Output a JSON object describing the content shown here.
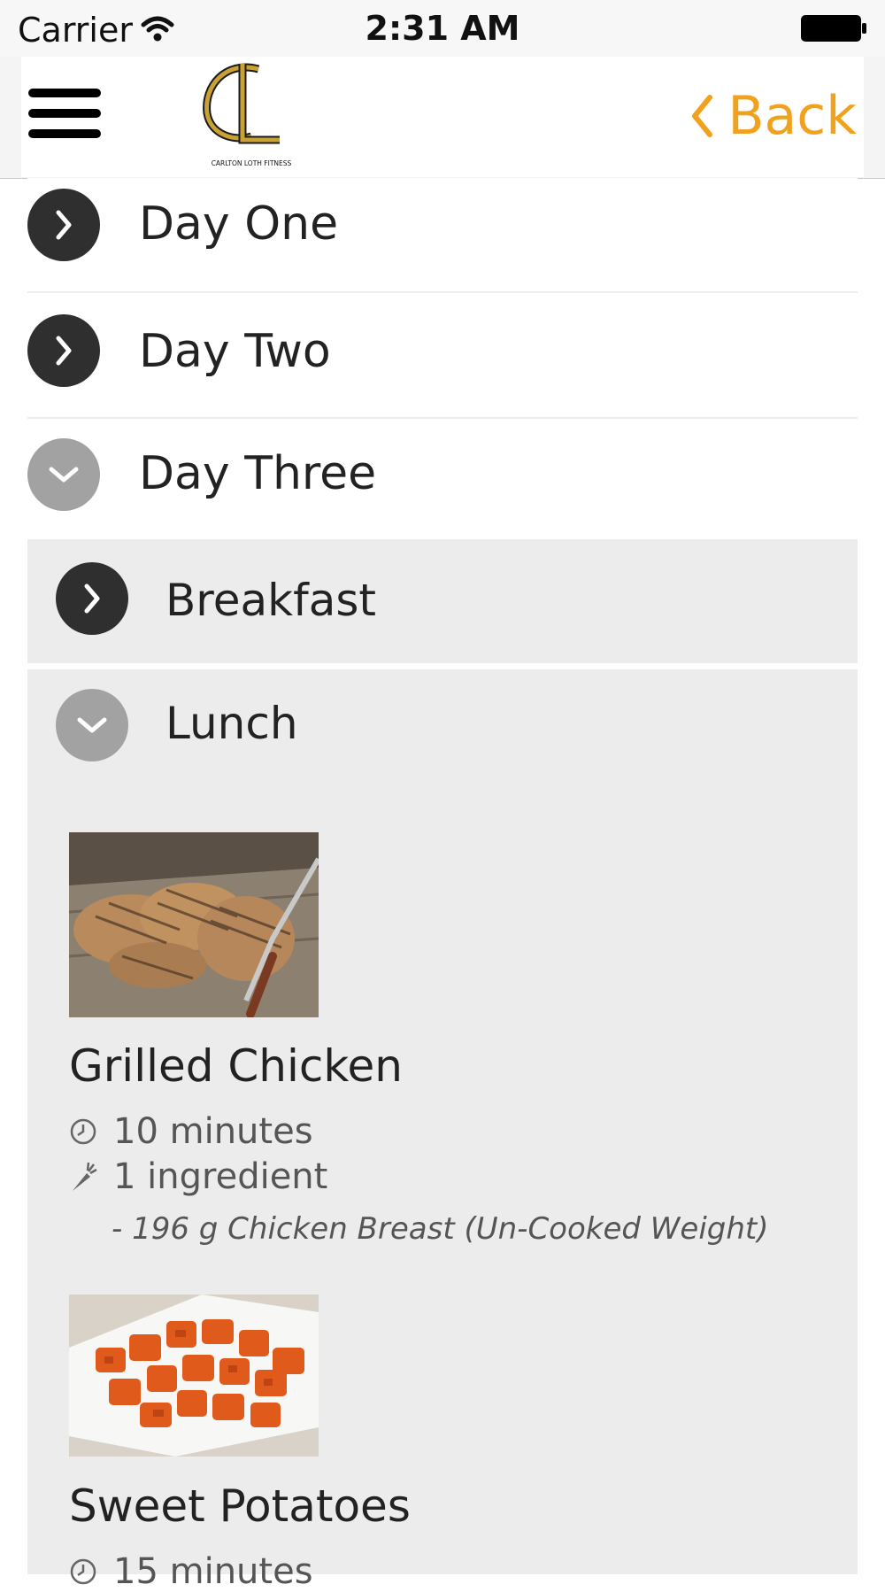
{
  "status_bar": {
    "carrier": "Carrier",
    "time": "2:31 AM"
  },
  "nav": {
    "logo_text": "CARLTON LOTH FITNESS",
    "back_label": "Back",
    "accent_color": "#f0a11e"
  },
  "days": [
    {
      "label": "Day One",
      "expanded": false
    },
    {
      "label": "Day Two",
      "expanded": false
    },
    {
      "label": "Day Three",
      "expanded": true
    }
  ],
  "meals": [
    {
      "label": "Breakfast",
      "expanded": false
    },
    {
      "label": "Lunch",
      "expanded": true
    }
  ],
  "recipes": [
    {
      "name": "Grilled Chicken",
      "time": "10 minutes",
      "ingredients_count": "1 ingredient",
      "ingredients": [
        "- 196 g Chicken Breast (Un-Cooked Weight)"
      ],
      "image": "grilled-chicken-photo"
    },
    {
      "name": "Sweet Potatoes",
      "time": "15 minutes",
      "image": "sweet-potatoes-photo"
    }
  ]
}
